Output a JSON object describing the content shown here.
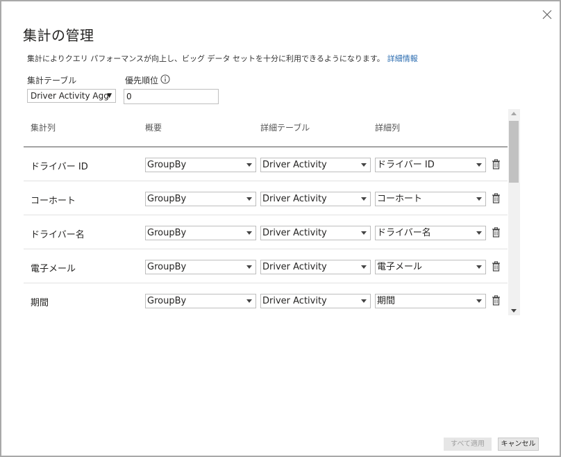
{
  "dialog": {
    "title": "集計の管理",
    "description": "集計によりクエリ パフォーマンスが向上し、ビッグ データ セットを十分に利用できるようになります。",
    "learn_more": "詳細情報"
  },
  "aggregation_table": {
    "label": "集計テーブル",
    "value": "Driver Activity Agg"
  },
  "precedence": {
    "label": "優先順位",
    "value": "0"
  },
  "columns": [
    "集計列",
    "概要",
    "詳細テーブル",
    "詳細列"
  ],
  "rows": [
    {
      "name": "ドライバー ID",
      "summary": "GroupBy",
      "detail_table": "Driver Activity",
      "detail_column": "ドライバー ID"
    },
    {
      "name": "コーホート",
      "summary": "GroupBy",
      "detail_table": "Driver Activity",
      "detail_column": "コーホート"
    },
    {
      "name": "ドライバー名",
      "summary": "GroupBy",
      "detail_table": "Driver Activity",
      "detail_column": "ドライバー名"
    },
    {
      "name": "電子メール",
      "summary": "GroupBy",
      "detail_table": "Driver Activity",
      "detail_column": "電子メール"
    },
    {
      "name": "期間",
      "summary": "GroupBy",
      "detail_table": "Driver Activity",
      "detail_column": "期間"
    }
  ],
  "buttons": {
    "apply_all": "すべて適用",
    "cancel": "キャンセル"
  },
  "colors": {
    "link": "#2b6cb0",
    "disabled_text": "#a0a0a0",
    "border": "#bdbdbd"
  },
  "icons": {
    "close": "close-icon",
    "info": "info-icon",
    "delete": "trash-icon",
    "dropdown": "chevron-down-icon"
  }
}
